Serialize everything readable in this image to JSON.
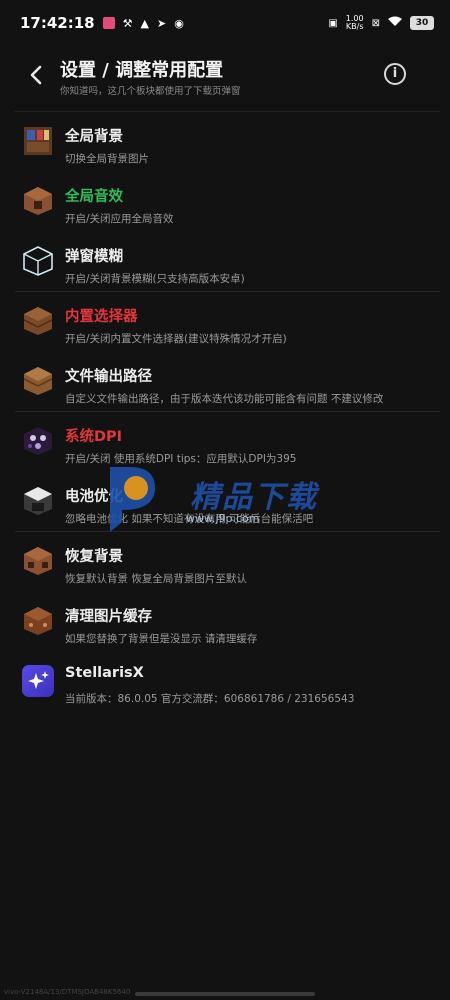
{
  "status": {
    "time": "17:42:18",
    "net_value": "1.00",
    "net_unit": "KB/s",
    "battery": "30"
  },
  "header": {
    "title": "设置 / 调整常用配置",
    "subtitle": "你知道吗，这几个板块都使用了下载页弹窗",
    "info_glyph": "i"
  },
  "items": [
    {
      "label": "全局背景",
      "desc": "切换全局背景图片",
      "color": "#ececec",
      "icon": "book-block-icon"
    },
    {
      "label": "全局音效",
      "desc": "开启/关闭应用全局音效",
      "color": "#2dbd5a",
      "icon": "note-block-icon"
    },
    {
      "label": "弹窗模糊",
      "desc": "开启/关闭背景模糊(只支持高版本安卓)",
      "color": "#ececec",
      "icon": "glass-block-icon"
    },
    {
      "label": "内置选择器",
      "desc": "开启/关闭内置文件选择器(建议特殊情况才开启)",
      "color": "#e0363c",
      "icon": "barrel-icon"
    },
    {
      "label": "文件输出路径",
      "desc": "自定义文件输出路径，由于版本迭代该功能可能含有问题 不建议修改",
      "color": "#ececec",
      "icon": "chest-icon"
    },
    {
      "label": "系统DPI",
      "desc": "开启/关闭 使用系统DPI tips：应用默认DPI为395",
      "color": "#e0363c",
      "icon": "crying-obsidian-icon"
    },
    {
      "label": "电池优化",
      "desc": "忽略电池优化 如果不知道有没有用 可能后台能保活吧",
      "color": "#ececec",
      "icon": "furnace-icon"
    },
    {
      "label": "恢复背景",
      "desc": "恢复默认背景 恢复全局背景图片至默认",
      "color": "#ececec",
      "icon": "jukebox-icon"
    },
    {
      "label": "清理图片缓存",
      "desc": "如果您替换了背景但是没显示 请清理缓存",
      "color": "#ececec",
      "icon": "crafting-block-icon"
    },
    {
      "label": "StellarisX",
      "desc": "当前版本：86.0.05 官方交流群：606861786 / 231656543",
      "color": "#ececec",
      "icon": "stellaris-app-icon"
    }
  ],
  "watermark": {
    "text": "精品下载",
    "url": "www.j9p.com"
  },
  "footer_id": "vivo-V2148A/13/DTMSJOAB48K5640"
}
